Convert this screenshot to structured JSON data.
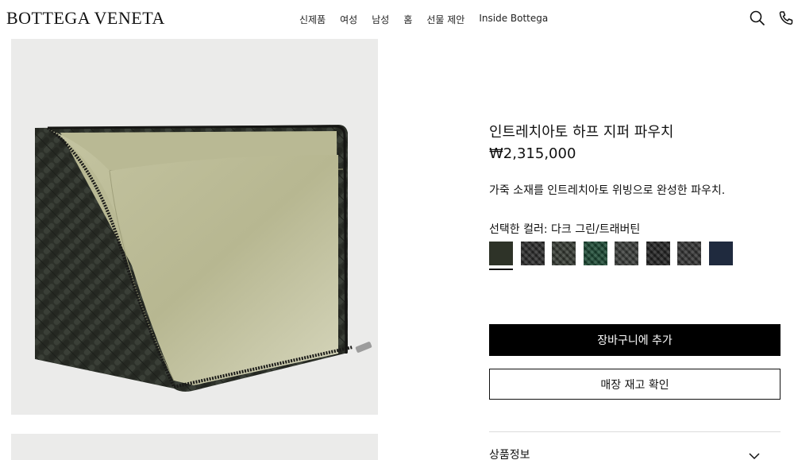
{
  "brand": {
    "logo_text": "BOTTEGA VENETA"
  },
  "nav": {
    "items": [
      {
        "label": "신제품"
      },
      {
        "label": "여성"
      },
      {
        "label": "남성"
      },
      {
        "label": "홈"
      },
      {
        "label": "선물 제안"
      },
      {
        "label": "Inside Bottega"
      }
    ]
  },
  "header_icons": {
    "search": "search-icon",
    "phone": "phone-icon"
  },
  "gallery": {
    "dot_count": 3,
    "active_index": 1
  },
  "product": {
    "title": "인트레치아토 하프 지퍼 파우치",
    "price": "₩2,315,000",
    "description": "가죽 소재를 인트레치아토 위빙으로 완성한 파우치.",
    "color_label": "선택한 컬러:",
    "color_value": "다크 그린/트래버틴",
    "swatches": [
      {
        "color": "#2e3328",
        "selected": true,
        "pattern": "solid"
      },
      {
        "color": "#2b2b2b",
        "selected": false,
        "pattern": "weave"
      },
      {
        "color": "#353a33",
        "selected": false,
        "pattern": "weave"
      },
      {
        "color": "#1b4a34",
        "selected": false,
        "pattern": "weave"
      },
      {
        "color": "#3a3d3a",
        "selected": false,
        "pattern": "weave"
      },
      {
        "color": "#222222",
        "selected": false,
        "pattern": "weave"
      },
      {
        "color": "#343434",
        "selected": false,
        "pattern": "weave"
      },
      {
        "color": "#1f2a3e",
        "selected": false,
        "pattern": "solid"
      }
    ]
  },
  "actions": {
    "add_to_cart": "장바구니에 추가",
    "check_store": "매장 재고 확인"
  },
  "accordion": {
    "product_info": "상품정보"
  },
  "colors": {
    "primary_button_bg": "#000000",
    "image_background": "#ebebea",
    "pouch_exterior": "#2c3029",
    "pouch_interior": "#bdbd98"
  }
}
